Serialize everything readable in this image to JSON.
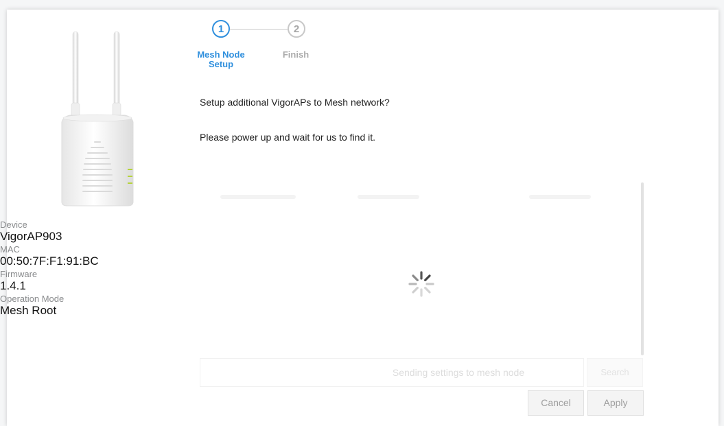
{
  "device_info": {
    "device_label": "Device",
    "device_value": "VigorAP903",
    "mac_label": "MAC",
    "mac_value": "00:50:7F:F1:91:BC",
    "firmware_label": "Firmware",
    "firmware_value": "1.4.1",
    "mode_label": "Operation Mode",
    "mode_value": "Mesh Root"
  },
  "stepper": {
    "steps": [
      {
        "number": "1",
        "label": "Mesh Node Setup",
        "state": "active"
      },
      {
        "number": "2",
        "label": "Finish",
        "state": "inactive"
      }
    ]
  },
  "content": {
    "question": "Setup additional VigorAPs to Mesh network?",
    "instruction": "Please power up and wait for us to find it.",
    "status_text": "Sending settings to mesh node",
    "search_label": "Search"
  },
  "footer": {
    "cancel_label": "Cancel",
    "apply_label": "Apply"
  },
  "colors": {
    "accent": "#2f8fdd",
    "inactive": "#c8c8c8",
    "led": "#b5d33a"
  },
  "icons": {
    "spinner": "loading-spinner-icon",
    "device": "access-point-image"
  }
}
